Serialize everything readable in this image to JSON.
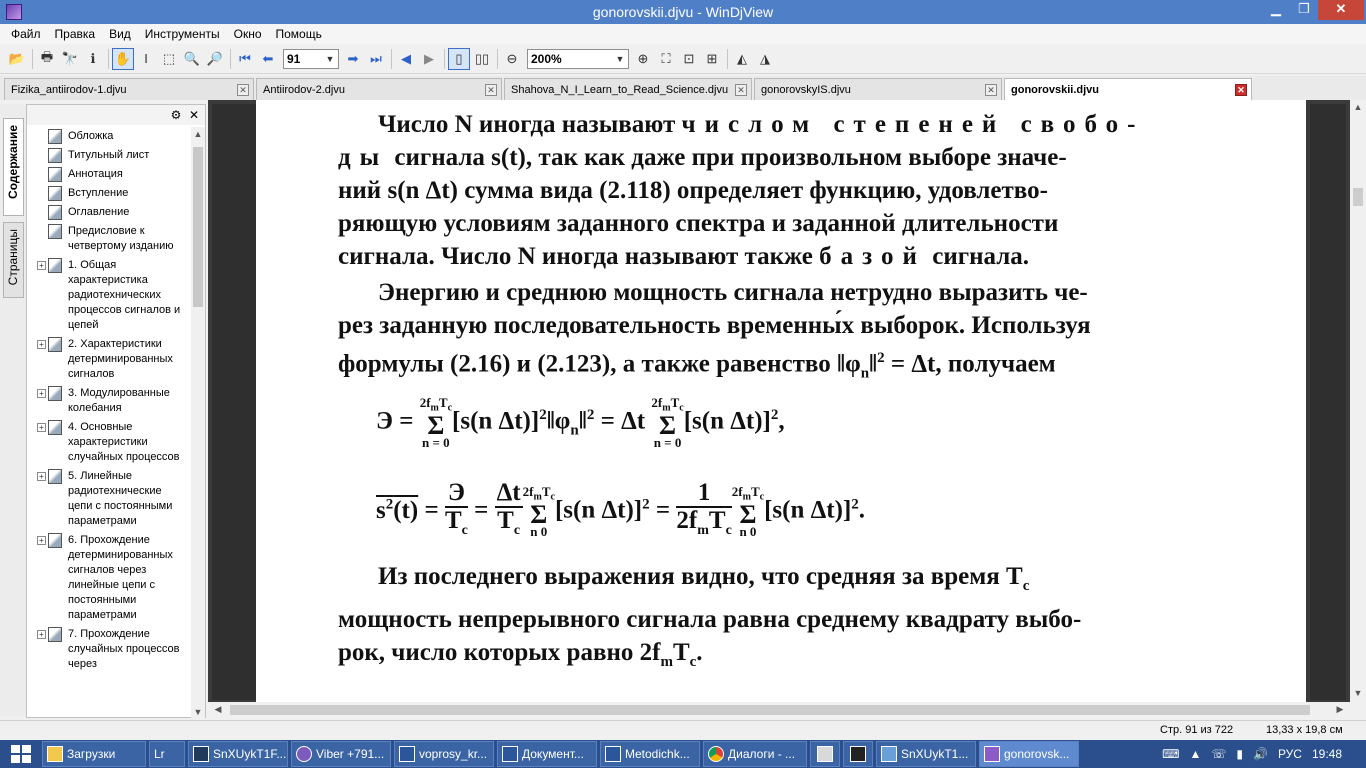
{
  "window": {
    "title": "gonorovskii.djvu - WinDjView"
  },
  "menu": [
    "Файл",
    "Правка",
    "Вид",
    "Инструменты",
    "Окно",
    "Помощь"
  ],
  "toolbar": {
    "page_value": "91",
    "zoom_value": "200%"
  },
  "tabs": [
    {
      "label": "Fizika_antiirodov-1.djvu",
      "active": false
    },
    {
      "label": "Antiirodov-2.djvu",
      "active": false
    },
    {
      "label": "Shahova_N_I_Learn_to_Read_Science.djvu",
      "active": false
    },
    {
      "label": "gonorovskyIS.djvu",
      "active": false
    },
    {
      "label": "gonorovskii.djvu",
      "active": true
    }
  ],
  "side_tabs": {
    "contents": "Содержание",
    "pages": "Страницы"
  },
  "toc": [
    {
      "label": "Обложка",
      "expandable": false
    },
    {
      "label": "Титульный лист",
      "expandable": false
    },
    {
      "label": "Аннотация",
      "expandable": false
    },
    {
      "label": "Вступление",
      "expandable": false
    },
    {
      "label": "Оглавление",
      "expandable": false
    },
    {
      "label": "Предисловие к четвертому изданию",
      "expandable": false
    },
    {
      "label": "1. Общая характеристика радиотехнических процессов сигналов и цепей",
      "expandable": true
    },
    {
      "label": "2. Характеристики детерминированных сигналов",
      "expandable": true
    },
    {
      "label": "3. Модулированные колебания",
      "expandable": true
    },
    {
      "label": "4. Основные характеристики случайных процессов",
      "expandable": true
    },
    {
      "label": "5. Линейные радиотехнические цепи с постоянными параметрами",
      "expandable": true
    },
    {
      "label": "6. Прохождение детерминированных сигналов через линейные цепи с постоянными параметрами",
      "expandable": true
    },
    {
      "label": "7. Прохождение случайных процессов через",
      "expandable": true
    }
  ],
  "doc": {
    "para1_lines": [
      "Число N иногда называют",
      "числом степеней свобо-",
      "ды",
      "сигнала s(t), так как даже при произвольном выборе значе-",
      "ний s(n Δt) сумма вида (2.118) определяет функцию, удовлетво-",
      "ряющую условиям заданного спектра и заданной длительности",
      "сигнала. Число N иногда называют также",
      "базой",
      "сигнала."
    ],
    "para2_lines": [
      "Энергию и среднюю мощность сигнала нетрудно выразить че-",
      "рез заданную последовательность временны́х выборок. Используя",
      "формулы (2.16) и (2.123), а также равенство ‖φ",
      "n",
      "‖",
      "2",
      " = Δt, получаем"
    ],
    "formula1": {
      "lhs": "Э = ",
      "sum_top": "2f",
      "sum_top_sub": "m",
      "sum_top_T": "T",
      "sum_top_c": "c",
      "sum_bottom": "n = 0",
      "term1": "[s(n Δt)]",
      "exp": "2",
      "norm": "‖φ",
      "norm_sub": "n",
      "norm_close": "‖",
      "mid": " = Δt ",
      "term2": "[s(n Δt)]",
      "end": ","
    },
    "formula2": {
      "lhs_base": "s",
      "lhs_exp": "2",
      "lhs_arg": "(t)",
      "eq": " = ",
      "frac1_num": "Э",
      "frac1_den_T": "T",
      "frac1_den_c": "c",
      "frac2_num": "Δt",
      "frac2_den_T": "T",
      "frac2_den_c": "c",
      "sum_bottom_n": "n",
      "sum_bottom_0": "0",
      "term": "[s(n Δt)]",
      "exp": "2",
      "frac3_num": "1",
      "frac3_den": "2f",
      "frac3_den_m": "m",
      "frac3_den_T": "T",
      "frac3_den_c": "c",
      "end": "."
    },
    "para3_lines": [
      "Из последнего выражения видно, что средняя за время T",
      "c",
      "мощность непрерывного сигнала равна среднему квадрату выбо-",
      "рок, число которых равно 2f",
      "m",
      "T",
      "c",
      "."
    ]
  },
  "status": {
    "page": "Стр. 91 из 722",
    "size": "13,33 x 19,8 см"
  },
  "taskbar": {
    "items": [
      {
        "label": "Загрузки",
        "active": false
      },
      {
        "label": "Lr",
        "active": false
      },
      {
        "label": "SnXUykT1F...",
        "active": false
      },
      {
        "label": "Viber +791...",
        "active": false
      },
      {
        "label": "voprosy_kr...",
        "active": false
      },
      {
        "label": "Документ...",
        "active": false
      },
      {
        "label": "Metodichk...",
        "active": false
      },
      {
        "label": "Диалоги - ...",
        "active": false
      },
      {
        "label": "",
        "active": false
      },
      {
        "label": "",
        "active": false
      },
      {
        "label": "SnXUykT1...",
        "active": false
      },
      {
        "label": "gonorovsk...",
        "active": true
      }
    ],
    "lang": "РУС",
    "time": "19:48"
  }
}
